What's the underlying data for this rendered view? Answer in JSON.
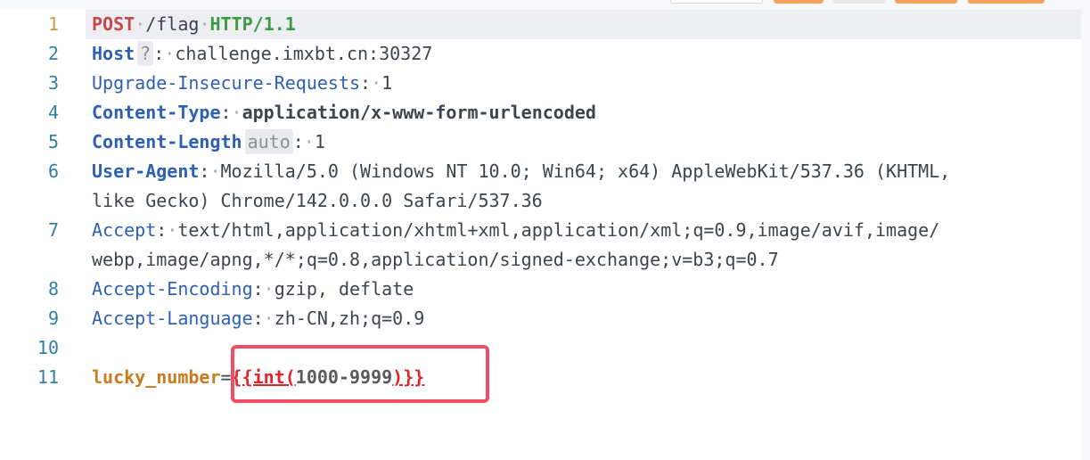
{
  "toolbar": {
    "buttons": [
      {
        "label": "",
        "style": "white"
      },
      {
        "label": "",
        "style": "orange"
      },
      {
        "label": "",
        "style": "gray"
      },
      {
        "label": "",
        "style": "orange"
      },
      {
        "label": "",
        "style": "orange"
      }
    ]
  },
  "editor": {
    "lines": [
      {
        "n": "1"
      },
      {
        "n": "2"
      },
      {
        "n": "3"
      },
      {
        "n": "4"
      },
      {
        "n": "5"
      },
      {
        "n": "6"
      },
      {
        "n": "7"
      },
      {
        "n": "8"
      },
      {
        "n": "9"
      },
      {
        "n": "10"
      },
      {
        "n": "11"
      }
    ],
    "request_line": {
      "method": "POST",
      "path": "/flag",
      "protocol": "HTTP/1.1"
    },
    "headers": {
      "host": {
        "name": "Host",
        "hint": "?",
        "value": "challenge.imxbt.cn:30327"
      },
      "upgrade": {
        "name": "Upgrade-Insecure-Requests",
        "value": "1"
      },
      "content_type": {
        "name": "Content-Type",
        "value": "application/x-www-form-urlencoded"
      },
      "content_length": {
        "name": "Content-Length",
        "hint": "auto",
        "value": "1"
      },
      "user_agent": {
        "name": "User-Agent",
        "value_line1": "Mozilla/5.0 (Windows NT 10.0; Win64; x64) AppleWebKit/537.36 (KHTML, ",
        "value_line2": "like Gecko) Chrome/142.0.0.0 Safari/537.36"
      },
      "accept": {
        "name": "Accept",
        "value_line1": "text/html,application/xhtml+xml,application/xml;q=0.9,image/avif,image/",
        "value_line2": "webp,image/apng,*/*;q=0.8,application/signed-exchange;v=b3;q=0.7"
      },
      "accept_encoding": {
        "name": "Accept-Encoding",
        "value": "gzip, deflate"
      },
      "accept_language": {
        "name": "Accept-Language",
        "value": "zh-CN,zh;q=0.9"
      }
    },
    "body": {
      "param": "lucky_number",
      "equals": "=",
      "tpl_open": "{{int(",
      "tpl_value": "1000-9999",
      "tpl_close": ")}}"
    }
  },
  "colors": {
    "highlight_box": "#f04e64",
    "method": "#c24a4a",
    "protocol": "#3c9a46",
    "header_name": "#2d5fb3",
    "line_number": "#2f7fa8",
    "active_line_number": "#d99346",
    "body_param": "#c97a1f",
    "template": "#e0242b"
  }
}
